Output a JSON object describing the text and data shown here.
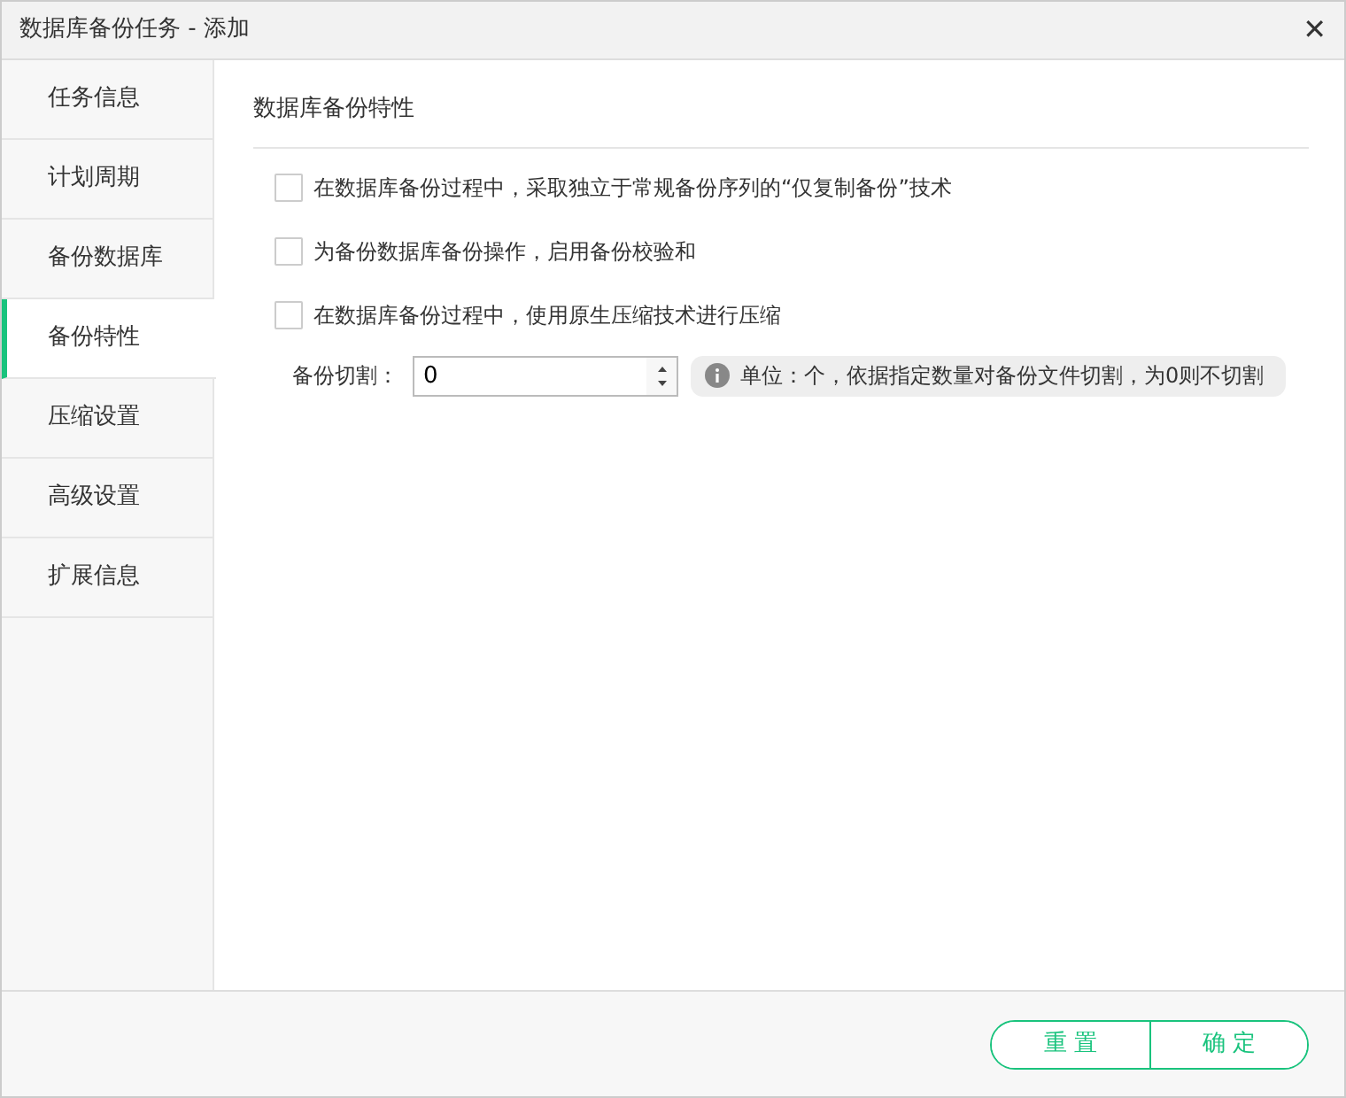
{
  "window": {
    "title": "数据库备份任务 - 添加",
    "close": "✕"
  },
  "sidebar": {
    "items": [
      {
        "label": "任务信息",
        "selected": false
      },
      {
        "label": "计划周期",
        "selected": false
      },
      {
        "label": "备份数据库",
        "selected": false
      },
      {
        "label": "备份特性",
        "selected": true
      },
      {
        "label": "压缩设置",
        "selected": false
      },
      {
        "label": "高级设置",
        "selected": false
      },
      {
        "label": "扩展信息",
        "selected": false
      }
    ]
  },
  "section": {
    "title": "数据库备份特性",
    "options": [
      {
        "label": "在数据库备份过程中，采取独立于常规备份序列的“仅复制备份”技术",
        "checked": false
      },
      {
        "label": "为备份数据库备份操作，启用备份校验和",
        "checked": false
      },
      {
        "label": "在数据库备份过程中，使用原生压缩技术进行压缩",
        "checked": false
      }
    ],
    "split": {
      "label": "备份切割：",
      "value": "0",
      "hint": "单位：个，依据指定数量对备份文件切割，为0则不切割"
    }
  },
  "buttons": [
    "重 置",
    "确 定"
  ]
}
